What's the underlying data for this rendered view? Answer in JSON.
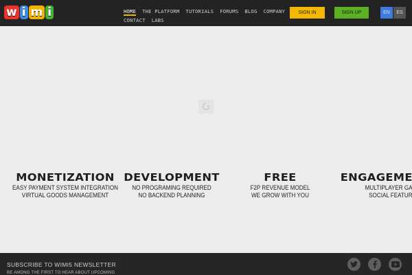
{
  "header": {
    "logo_text": "wimi",
    "nav_row1": [
      "HOME",
      "THE PLATFORM",
      "TUTORIALS",
      "FORUMS",
      "BLOG",
      "COMPANY"
    ],
    "nav_row2": [
      "CONTACT",
      "LABS"
    ],
    "signin_label": "SIGN IN",
    "signup_label": "SIGN UP",
    "lang_en": "EN",
    "lang_es": "ES"
  },
  "features": [
    {
      "title": "MONETIZATION",
      "line1": "EASY PAYMENT SYSTEM INTEGRATION",
      "line2": "VIRTUAL GOODS MANAGEMENT"
    },
    {
      "title": "DEVELOPMENT",
      "line1": "NO PROGRAMING REQUIRED",
      "line2": "NO BACKEND PLANNING"
    },
    {
      "title": "FREE",
      "line1": "F2P REVENUE MODEL",
      "line2": "WE GROW WITH YOU"
    },
    {
      "title": "ENGAGEMENT",
      "line1": "MULTIPLAYER GAMES",
      "line2": "SOCIAL FEATURES"
    }
  ],
  "footer": {
    "newsletter_title": "SUBSCRIBE TO WIMI5 NEWSLETTER",
    "newsletter_sub": "BE AMONG THE FIRST TO HEAR ABOUT UPCOMING"
  },
  "colors": {
    "signin": "#f5b800",
    "signup": "#5bb024",
    "lang_active": "#3f7ae0"
  },
  "icons": [
    "twitter-icon",
    "facebook-icon",
    "youtube-icon",
    "loading-icon"
  ]
}
